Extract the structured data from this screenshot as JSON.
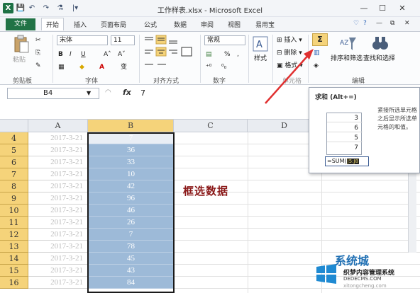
{
  "titlebar": {
    "title": "工作样表.xlsx - Microsoft Excel",
    "logo": "X",
    "quick_access": [
      "💾",
      "↶",
      "↷",
      "⚗",
      "|▾"
    ],
    "window_buttons": [
      "—",
      "☐",
      "✕"
    ]
  },
  "tabs": {
    "file": "文件",
    "items": [
      "开始",
      "插入",
      "页面布局",
      "公式",
      "数据",
      "审阅",
      "视图",
      "易用宝"
    ],
    "active_index": 0,
    "right_icons": [
      "♡",
      "?",
      "—",
      "⧉",
      "✕"
    ]
  },
  "ribbon": {
    "clipboard": {
      "paste": "粘贴",
      "group": "剪贴板"
    },
    "font": {
      "name": "宋体",
      "size": "11",
      "bold": "B",
      "italic": "I",
      "underline": "U",
      "grow": "A˄",
      "shrink": "A˅",
      "wen": "变",
      "group": "字体"
    },
    "align": {
      "group": "对齐方式"
    },
    "number": {
      "format": "常规",
      "percent": "%",
      "comma": ",",
      "group": "数字"
    },
    "styles": {
      "label": "样式"
    },
    "cells": {
      "insert": "插入",
      "delete": "删除",
      "format": "格式",
      "group": "单元格"
    },
    "editing": {
      "sum": "Σ",
      "sort": "排序和筛选",
      "find": "查找和选择",
      "group": "编辑"
    }
  },
  "formula_bar": {
    "name_box": "B4",
    "fx": "fx",
    "value": "7"
  },
  "grid": {
    "columns": [
      "A",
      "B",
      "C",
      "D"
    ],
    "rows": [
      {
        "row": "4",
        "a": "2017-3-21",
        "b": "7"
      },
      {
        "row": "5",
        "a": "2017-3-21",
        "b": "36"
      },
      {
        "row": "6",
        "a": "2017-3-21",
        "b": "33"
      },
      {
        "row": "7",
        "a": "2017-3-21",
        "b": "10"
      },
      {
        "row": "8",
        "a": "2017-3-21",
        "b": "42"
      },
      {
        "row": "9",
        "a": "2017-3-21",
        "b": "96"
      },
      {
        "row": "10",
        "a": "2017-3-21",
        "b": "46"
      },
      {
        "row": "11",
        "a": "2017-3-21",
        "b": "26"
      },
      {
        "row": "12",
        "a": "2017-3-21",
        "b": "7"
      },
      {
        "row": "13",
        "a": "2017-3-21",
        "b": "78"
      },
      {
        "row": "14",
        "a": "2017-3-21",
        "b": "45"
      },
      {
        "row": "15",
        "a": "2017-3-21",
        "b": "43"
      },
      {
        "row": "16",
        "a": "2017-3-21",
        "b": "84"
      }
    ]
  },
  "annotation": "框选数据",
  "tooltip": {
    "title": "求和 (Alt+=)",
    "description": "紧接所选单元格之后显示所选单元格的和值。",
    "sample_values": [
      "3",
      "6",
      "5",
      "7"
    ],
    "formula": "=SUM(",
    "formula_ref": "J5:J8"
  },
  "watermark": {
    "line1": "系统城",
    "line2": "织梦内容管理系统",
    "line3": "DEDECMS.COM",
    "line4": "xitongcheng.com"
  },
  "colors": {
    "excel_green": "#217346",
    "selection_fill": "#9dbad8",
    "header_highlight": "#f5d37a",
    "annotation": "#8b1a1a",
    "arrow": "#e03030"
  }
}
